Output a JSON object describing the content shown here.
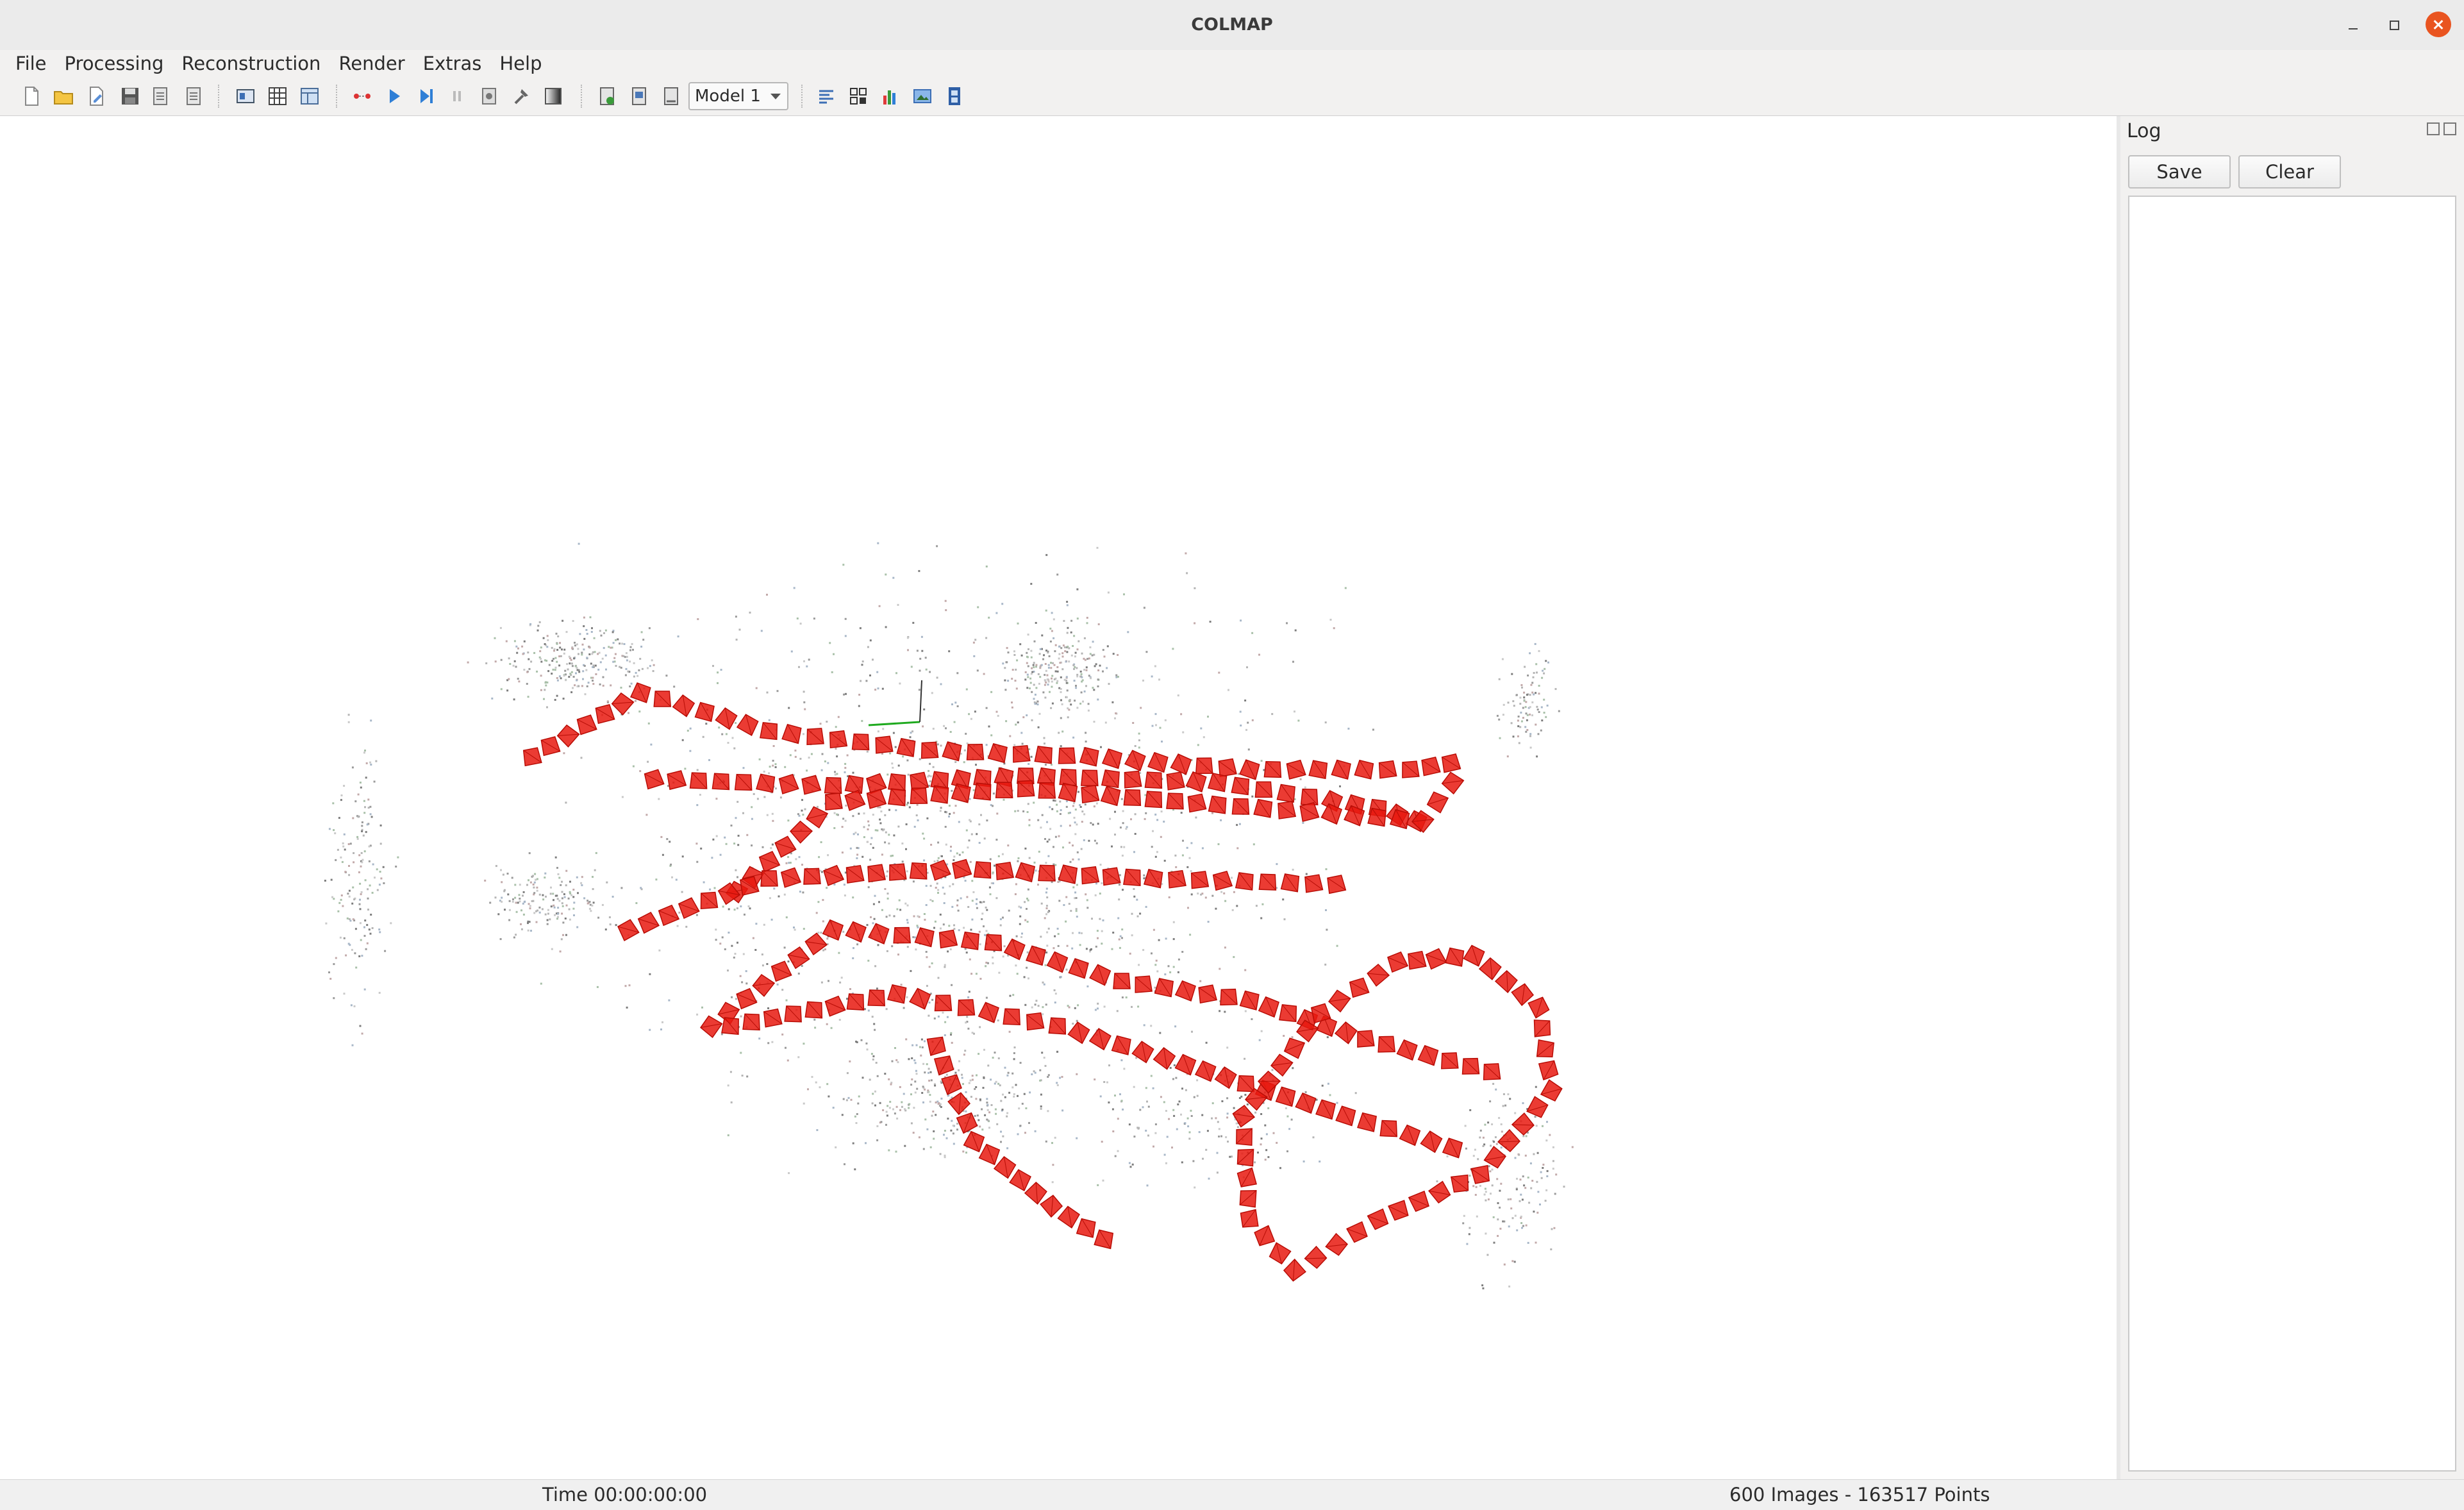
{
  "window": {
    "title": "COLMAP"
  },
  "menubar": {
    "items": [
      "File",
      "Processing",
      "Reconstruction",
      "Render",
      "Extras",
      "Help"
    ]
  },
  "toolbar": {
    "buttons": [
      {
        "icon": "new-project-icon"
      },
      {
        "icon": "open-project-icon"
      },
      {
        "icon": "edit-project-icon"
      },
      {
        "icon": "save-project-icon"
      },
      {
        "icon": "import-model-icon"
      },
      {
        "icon": "export-model-icon"
      },
      {
        "icon": "feature-extraction-icon"
      },
      {
        "icon": "feature-matching-icon"
      },
      {
        "icon": "database-management-icon"
      },
      {
        "icon": "automatic-reconstruction-icon"
      },
      {
        "icon": "start-reconstruction-icon"
      },
      {
        "icon": "step-reconstruction-icon"
      },
      {
        "icon": "pause-reconstruction-icon"
      },
      {
        "icon": "reconstruction-options-icon"
      },
      {
        "icon": "bundle-adjustment-icon"
      },
      {
        "icon": "dense-reconstruction-icon"
      },
      {
        "icon": "grab-image-icon"
      },
      {
        "icon": "grab-movie-icon"
      },
      {
        "icon": "render-options-icon"
      },
      {
        "icon": "reconstruction-stats-icon"
      },
      {
        "icon": "match-matrix-icon"
      },
      {
        "icon": "show-log-icon"
      },
      {
        "icon": "undistort-icon"
      },
      {
        "icon": "film-icon"
      }
    ],
    "model_select": {
      "value": "Model 1"
    }
  },
  "log_panel": {
    "title": "Log",
    "save_label": "Save",
    "clear_label": "Clear",
    "content": ""
  },
  "statusbar": {
    "time": "Time 00:00:00:00",
    "stats": "600 Images - 163517 Points"
  },
  "colors": {
    "camera": "#e8190f",
    "accent": "#e95420",
    "background": "#ffffff"
  }
}
